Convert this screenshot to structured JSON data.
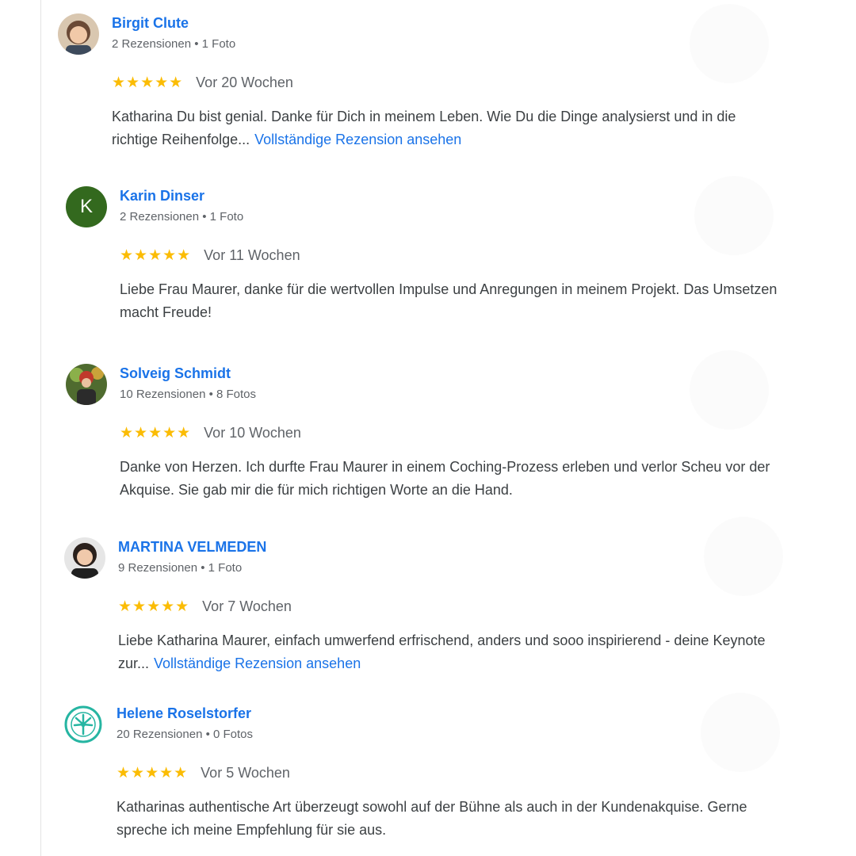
{
  "reviews": [
    {
      "name": "Birgit Clute",
      "meta": "2 Rezensionen • 1 Foto",
      "stars": "★★★★★",
      "date": "Vor 20 Wochen",
      "text": "Katharina Du bist genial. Danke für Dich in meinem Leben. Wie Du die Dinge analysierst und in die richtige Reihenfolge...",
      "more": "Vollständige Rezension ansehen"
    },
    {
      "name": "Karin Dinser",
      "avatar_letter": "K",
      "meta": "2 Rezensionen • 1 Foto",
      "stars": "★★★★★",
      "date": "Vor 11 Wochen",
      "text": "Liebe Frau Maurer, danke für die wertvollen Impulse und Anregungen in meinem Projekt. Das Umsetzen macht Freude!"
    },
    {
      "name": "Solveig Schmidt",
      "meta": "10 Rezensionen • 8 Fotos",
      "stars": "★★★★★",
      "date": "Vor 10 Wochen",
      "text": "Danke von Herzen. Ich durfte Frau Maurer in einem Coching-Prozess erleben und verlor Scheu vor der Akquise. Sie gab mir die für mich richtigen Worte an die Hand."
    },
    {
      "name": "MARTINA VELMEDEN",
      "meta": "9 Rezensionen • 1 Foto",
      "stars": "★★★★★",
      "date": "Vor 7 Wochen",
      "text": "Liebe Katharina Maurer, einfach umwerfend erfrischend, anders und sooo inspirierend - deine Keynote zur...",
      "more": "Vollständige Rezension ansehen"
    },
    {
      "name": "Helene Roselstorfer",
      "meta": "20 Rezensionen • 0 Fotos",
      "stars": "★★★★★",
      "date": "Vor 5 Wochen",
      "text": "Katharinas authentische Art überzeugt sowohl auf der Bühne als auch in der Kundenakquise. Gerne spreche ich meine Empfehlung für sie aus."
    }
  ],
  "colors": {
    "link": "#1a73e8",
    "star": "#fbbc04",
    "meta_text": "#5f6368",
    "body_text": "#3c4043",
    "letter_avatar_bg": "#33691e"
  }
}
